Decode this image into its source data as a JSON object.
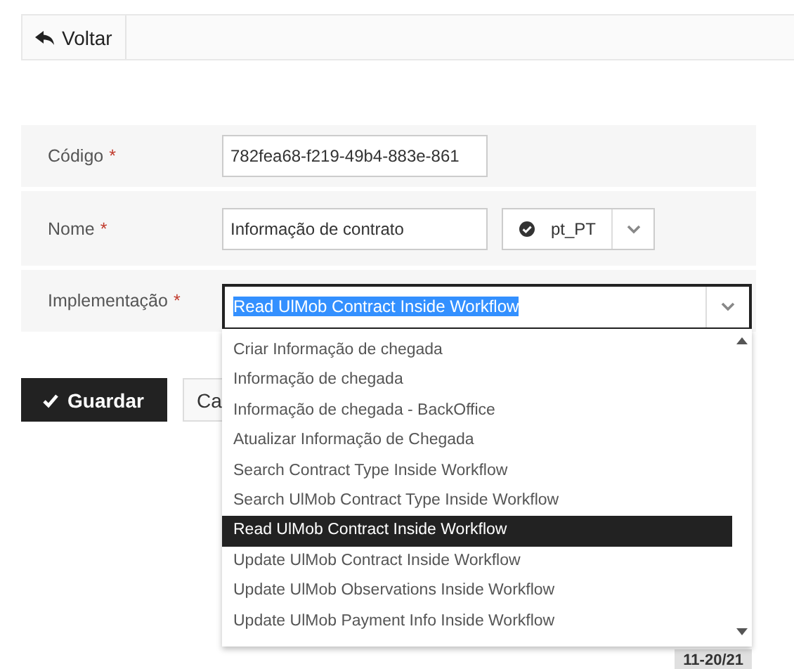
{
  "toolbar": {
    "back_button": "Voltar"
  },
  "form": {
    "fields": [
      {
        "kind": "text",
        "label": "Código",
        "required_mark": "*",
        "value": "782fea68-f219-49b4-883e-861"
      },
      {
        "kind": "text_locale",
        "label": "Nome",
        "required_mark": "*",
        "value": "Informação de contrato",
        "locale": "pt_PT"
      },
      {
        "kind": "select",
        "label": "Implementação",
        "required_mark": "*",
        "value": "Read UlMob Contract Inside Workflow",
        "focused": true
      }
    ]
  },
  "dropdown": {
    "options": [
      {
        "label": "Criar Informação de chegada",
        "selected": false
      },
      {
        "label": "Informação de chegada",
        "selected": false
      },
      {
        "label": "Informação de chegada - BackOffice",
        "selected": false
      },
      {
        "label": "Atualizar Informação de Chegada",
        "selected": false
      },
      {
        "label": "Search Contract Type Inside Workflow",
        "selected": false
      },
      {
        "label": "Search UlMob Contract Type Inside Workflow",
        "selected": false
      },
      {
        "label": "Read UlMob Contract Inside Workflow",
        "selected": true
      },
      {
        "label": "Update UlMob Contract Inside Workflow",
        "selected": false
      },
      {
        "label": "Update UlMob Observations Inside Workflow",
        "selected": false
      },
      {
        "label": "Update UlMob Payment Info Inside Workflow",
        "selected": false
      }
    ]
  },
  "buttons": [
    {
      "kind": "primary",
      "label": "Guardar"
    },
    {
      "kind": "secondary",
      "label": "Ca"
    }
  ],
  "date_badge": "11-20/21"
}
